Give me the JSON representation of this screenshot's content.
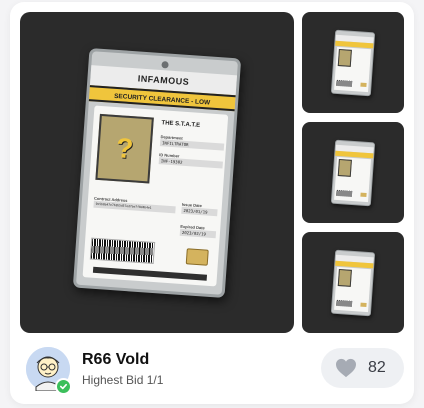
{
  "item": {
    "badge_header": "INFAMOUS",
    "badge_band": "SECURITY CLEARANCE - LOW",
    "org": "THE S.T.A.T.E",
    "department_label": "Department",
    "department_value": "INFILTRATOR",
    "id_label": "ID Number",
    "id_value": "INF-19302",
    "contract_label": "Contract Address",
    "contract_value": "0x5b8a47e7b2b5d57ed7ae7f0d4b4e1",
    "issue_label": "Issue Date",
    "issue_value": "2023/01/19",
    "expired_label": "Expired Date",
    "expired_value": "2023/02/19",
    "portrait_glyph": "?"
  },
  "creator": {
    "name": "R66 Vold",
    "subtitle": "Highest Bid 1/1"
  },
  "likes": {
    "count": "82"
  },
  "colors": {
    "accent_yellow": "#f0c53c",
    "verified_green": "#3bbf5b",
    "image_bg": "#2b2b2b"
  },
  "icons": {
    "like": "heart-icon",
    "verified": "check-badge-icon"
  }
}
